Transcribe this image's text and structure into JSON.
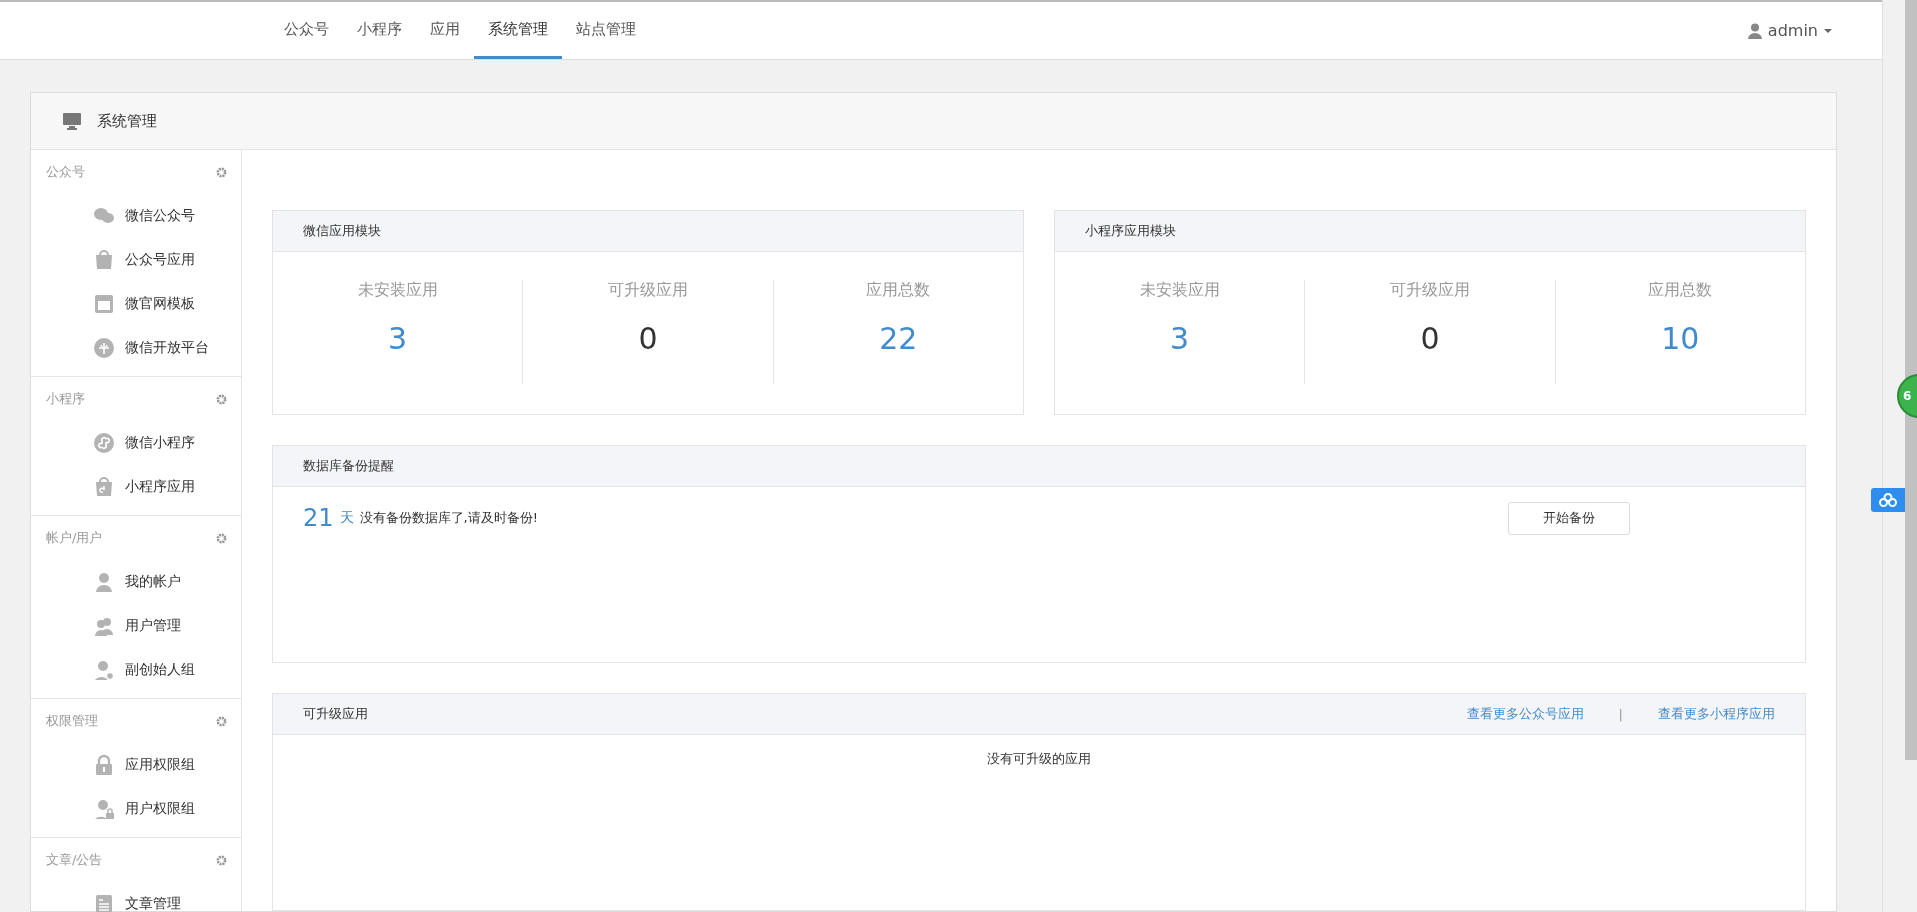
{
  "top_nav": {
    "tabs": [
      {
        "label": "公众号",
        "selected": false
      },
      {
        "label": "小程序",
        "selected": false
      },
      {
        "label": "应用",
        "selected": false
      },
      {
        "label": "系统管理",
        "selected": true
      },
      {
        "label": "站点管理",
        "selected": false
      }
    ],
    "user": "admin"
  },
  "panel": {
    "title": "系统管理"
  },
  "sidebar": {
    "groups": [
      {
        "title": "公众号",
        "items": [
          "微信公众号",
          "公众号应用",
          "微官网模板",
          "微信开放平台"
        ]
      },
      {
        "title": "小程序",
        "items": [
          "微信小程序",
          "小程序应用"
        ]
      },
      {
        "title": "帐户/用户",
        "items": [
          "我的帐户",
          "用户管理",
          "副创始人组"
        ]
      },
      {
        "title": "权限管理",
        "items": [
          "应用权限组",
          "用户权限组"
        ]
      },
      {
        "title": "文章/公告",
        "items": [
          "文章管理"
        ]
      }
    ]
  },
  "modules": [
    {
      "title": "微信应用模块",
      "stats": [
        {
          "label": "未安装应用",
          "value": "3",
          "color": "#428bca"
        },
        {
          "label": "可升级应用",
          "value": "0",
          "color": "#333333"
        },
        {
          "label": "应用总数",
          "value": "22",
          "color": "#428bca"
        }
      ]
    },
    {
      "title": "小程序应用模块",
      "stats": [
        {
          "label": "未安装应用",
          "value": "3",
          "color": "#428bca"
        },
        {
          "label": "可升级应用",
          "value": "0",
          "color": "#333333"
        },
        {
          "label": "应用总数",
          "value": "10",
          "color": "#428bca"
        }
      ]
    }
  ],
  "backup": {
    "title": "数据库备份提醒",
    "days": "21",
    "unit": "天",
    "message": "没有备份数据库了,请及时备份!",
    "button": "开始备份"
  },
  "upgradable": {
    "title": "可升级应用",
    "links": [
      "查看更多公众号应用",
      "查看更多小程序应用"
    ],
    "separator": "|",
    "empty_text": "没有可升级的应用"
  },
  "floating_badge": {
    "text": "6"
  }
}
